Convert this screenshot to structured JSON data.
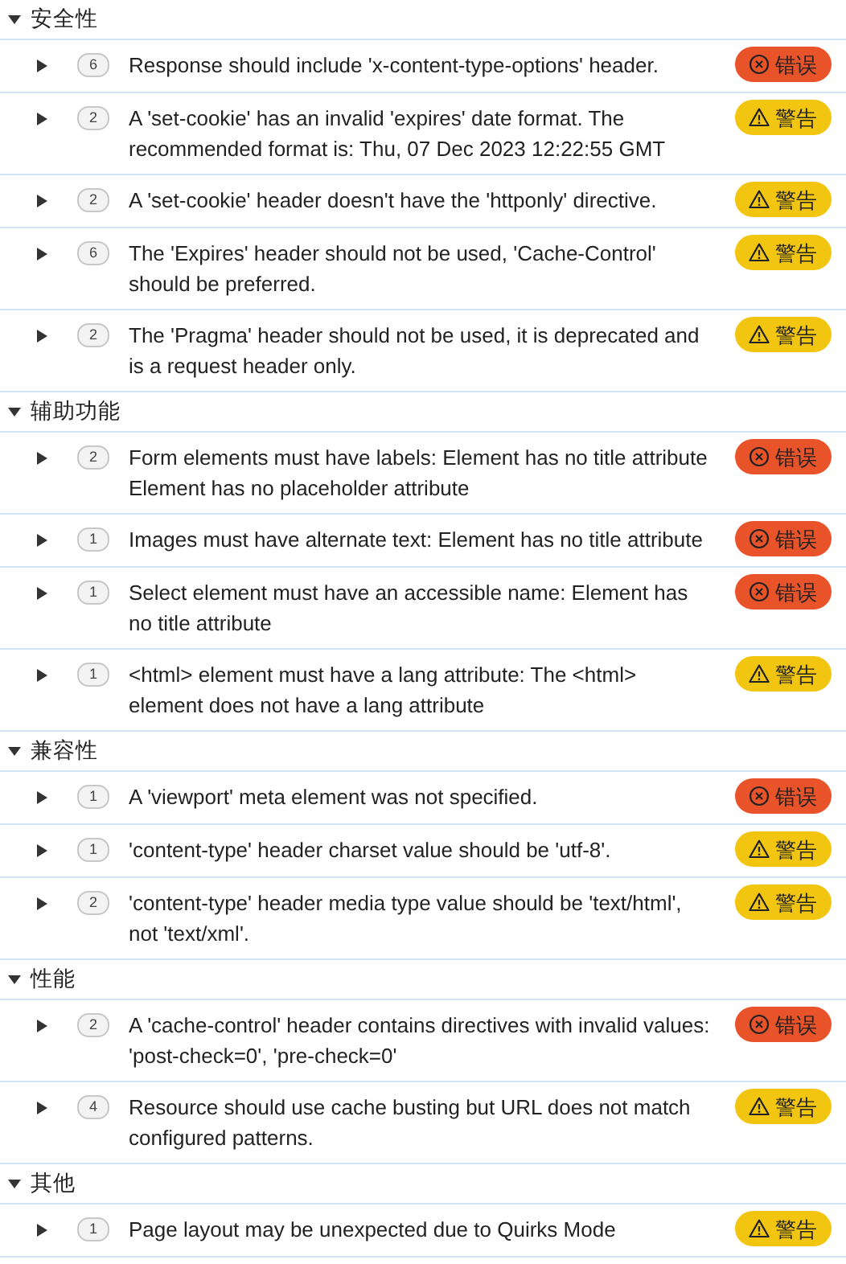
{
  "sections": [
    {
      "title": "安全性",
      "expanded": true,
      "issues": [
        {
          "count": "6",
          "expanded": false,
          "text": "Response should include 'x-content-type-options' header.",
          "severity": {
            "kind": "error",
            "label": "错误"
          }
        },
        {
          "count": "2",
          "expanded": false,
          "text": "A 'set-cookie' has an invalid 'expires' date format. The recommended format is: Thu, 07 Dec 2023 12:22:55 GMT",
          "severity": {
            "kind": "warning",
            "label": "警告"
          }
        },
        {
          "count": "2",
          "expanded": false,
          "text": "A 'set-cookie' header doesn't have the 'httponly' directive.",
          "severity": {
            "kind": "warning",
            "label": "警告"
          }
        },
        {
          "count": "6",
          "expanded": false,
          "text": "The 'Expires' header should not be used, 'Cache-Control' should be preferred.",
          "severity": {
            "kind": "warning",
            "label": "警告"
          }
        },
        {
          "count": "2",
          "expanded": false,
          "text": "The 'Pragma' header should not be used, it is deprecated and is a request header only.",
          "severity": {
            "kind": "warning",
            "label": "警告"
          }
        }
      ]
    },
    {
      "title": "辅助功能",
      "expanded": true,
      "issues": [
        {
          "count": "2",
          "expanded": false,
          "text": "Form elements must have labels: Element has no title attribute Element has no placeholder attribute",
          "severity": {
            "kind": "error",
            "label": "错误"
          }
        },
        {
          "count": "1",
          "expanded": false,
          "text": "Images must have alternate text: Element has no title attribute",
          "severity": {
            "kind": "error",
            "label": "错误"
          }
        },
        {
          "count": "1",
          "expanded": false,
          "text": "Select element must have an accessible name: Element has no title attribute",
          "severity": {
            "kind": "error",
            "label": "错误"
          }
        },
        {
          "count": "1",
          "expanded": false,
          "text": "<html> element must have a lang attribute: The <html> element does not have a lang attribute",
          "severity": {
            "kind": "warning",
            "label": "警告"
          }
        }
      ]
    },
    {
      "title": "兼容性",
      "expanded": true,
      "issues": [
        {
          "count": "1",
          "expanded": false,
          "text": "A 'viewport' meta element was not specified.",
          "severity": {
            "kind": "error",
            "label": "错误"
          }
        },
        {
          "count": "1",
          "expanded": false,
          "text": "'content-type' header charset value should be 'utf-8'.",
          "severity": {
            "kind": "warning",
            "label": "警告"
          }
        },
        {
          "count": "2",
          "expanded": false,
          "text": "'content-type' header media type value should be 'text/html', not 'text/xml'.",
          "severity": {
            "kind": "warning",
            "label": "警告"
          }
        }
      ]
    },
    {
      "title": "性能",
      "expanded": true,
      "issues": [
        {
          "count": "2",
          "expanded": false,
          "text": "A 'cache-control' header contains directives with invalid values: 'post-check=0', 'pre-check=0'",
          "severity": {
            "kind": "error",
            "label": "错误"
          }
        },
        {
          "count": "4",
          "expanded": false,
          "text": "Resource should use cache busting but URL does not match configured patterns.",
          "severity": {
            "kind": "warning",
            "label": "警告"
          }
        }
      ]
    },
    {
      "title": "其他",
      "expanded": true,
      "issues": [
        {
          "count": "1",
          "expanded": false,
          "text": "Page layout may be unexpected due to Quirks Mode",
          "severity": {
            "kind": "warning",
            "label": "警告"
          }
        }
      ]
    }
  ]
}
